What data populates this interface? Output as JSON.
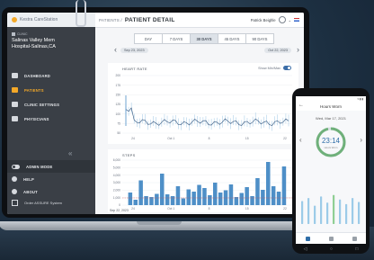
{
  "app": {
    "brand": "Kestra CareStation",
    "breadcrumb_parent": "PATIENTS /",
    "page_title": "PATIENT DETAIL",
    "user_name": "Patrick Beighle"
  },
  "sidebar": {
    "clinic_tag": "CLINIC",
    "clinic_name_line1": "Salinas Valley Mem",
    "clinic_name_line2": "Hospital-Salinas,CA",
    "items": [
      {
        "label": "DASHBOARD",
        "icon": "dashboard-icon"
      },
      {
        "label": "PATIENTS",
        "icon": "patients-icon",
        "active": true
      },
      {
        "label": "CLINIC SETTINGS",
        "icon": "settings-icon"
      },
      {
        "label": "PHYSICIANS",
        "icon": "physicians-icon"
      }
    ],
    "collapse_glyph": "«",
    "admin_mode": "ADMIN MODE",
    "help": "HELP",
    "about": "ABOUT",
    "order": "Order ASSURE System"
  },
  "range_tabs": [
    "DAY",
    "7 DAYS",
    "30 DAYS",
    "45 DAYS",
    "90 DAYS"
  ],
  "selected_range": "30 DAYS",
  "date_range": {
    "start": "Sep 23, 2023",
    "end": "Oct 22, 2023",
    "footer_start": "Sep 22, 2023"
  },
  "heart_rate": {
    "title": "HEART RATE",
    "toggle_label": "Show Min/Max",
    "y_ticks": [
      "200",
      "175",
      "150",
      "125",
      "100",
      "75",
      "50"
    ],
    "x_ticks": [
      "24",
      "Oct 1",
      "8",
      "15",
      "22"
    ]
  },
  "steps": {
    "title": "STEPS",
    "y_ticks": [
      "6,000",
      "5,000",
      "4,000",
      "3,000",
      "2,000",
      "1,000",
      "0"
    ],
    "x_ticks": [
      "24",
      "Oct 1",
      "8",
      "15",
      "22"
    ],
    "right_label": "1,5"
  },
  "phone": {
    "title": "Hours Worn",
    "date": "Wed, Mar 17, 2021",
    "time": "23:14",
    "time_caption": "Hours Worn"
  },
  "colors": {
    "accent": "#f4a928",
    "chart_blue": "#4e8fc7",
    "sidebar": "#3a3f46"
  }
}
